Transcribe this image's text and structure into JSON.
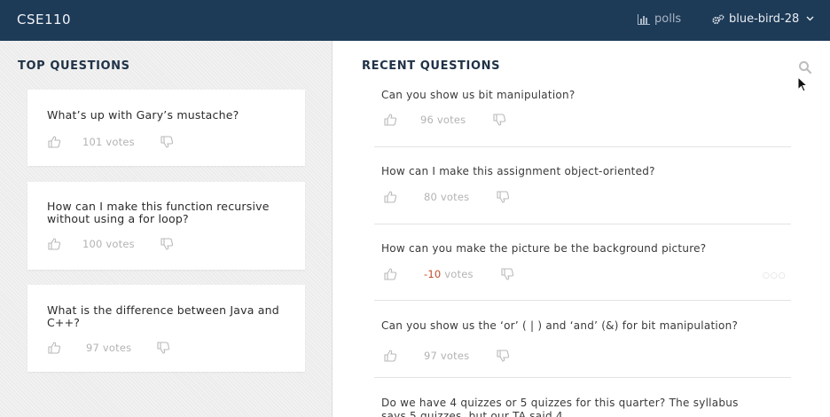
{
  "app": {
    "title": "CSE110",
    "polls_label": "polls",
    "username": "blue-bird-28"
  },
  "top_questions": {
    "heading": "TOP QUESTIONS",
    "items": [
      {
        "text": "What’s up with Gary’s mustache?",
        "votes": "101",
        "votes_suffix": "votes"
      },
      {
        "text": "How can I make this function recursive without using a for loop?",
        "votes": "100",
        "votes_suffix": "votes"
      },
      {
        "text": "What is the difference between Java and C++?",
        "votes": "97",
        "votes_suffix": "votes"
      }
    ]
  },
  "recent_questions": {
    "heading": "RECENT QUESTIONS",
    "items": [
      {
        "text": "Can you show us bit manipulation?",
        "votes": "96",
        "votes_suffix": "votes"
      },
      {
        "text": "How can I make this assignment object-oriented?",
        "votes": "80",
        "votes_suffix": "votes"
      },
      {
        "text": "How can you make the picture be the background picture?",
        "votes": "-10",
        "votes_suffix": "votes"
      },
      {
        "text": "Can you show us the ‘or’ ( | ) and ‘and’ (&) for bit manipulation?",
        "votes": "97",
        "votes_suffix": "votes"
      },
      {
        "text": "Do we have 4 quizzes or 5 quizzes for this quarter?  The syllabus says 5 quizzes, but our TA said 4",
        "votes": "",
        "votes_suffix": ""
      }
    ],
    "more_indicator": "○○○"
  },
  "colors": {
    "header_bg": "#1d3a57",
    "negative_vote": "#c24d2c"
  },
  "icons": [
    "bar-chart-icon",
    "gears-icon",
    "chevron-down-icon",
    "thumbs-up-icon",
    "thumbs-down-icon",
    "search-icon",
    "mouse-cursor-icon"
  ]
}
